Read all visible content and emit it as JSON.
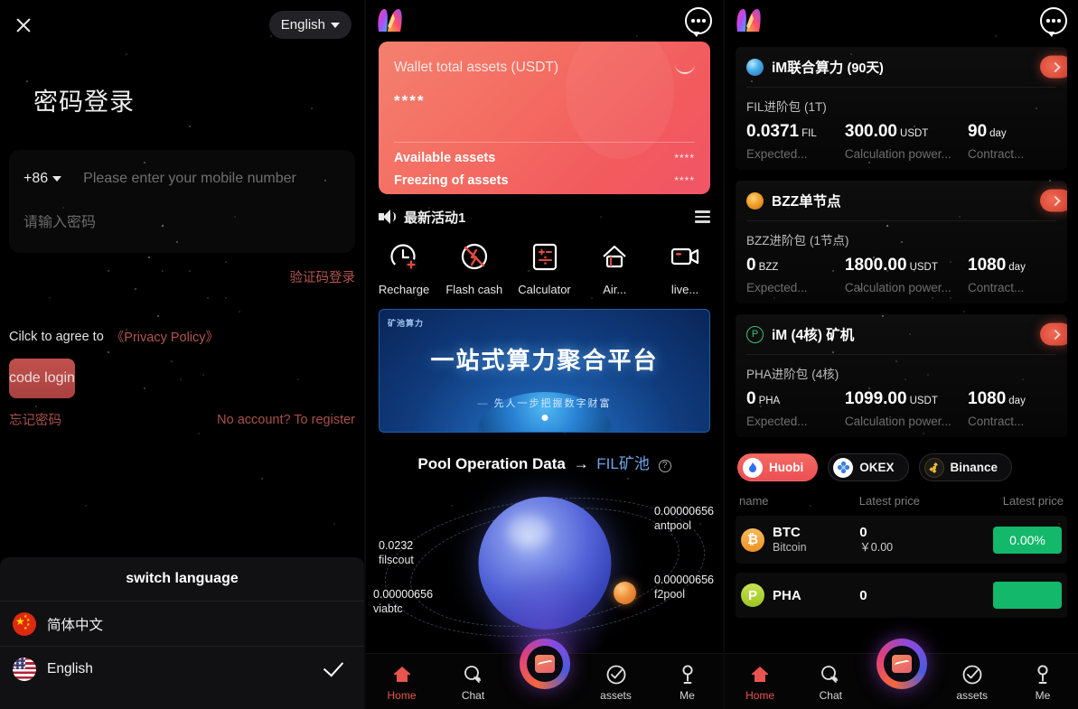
{
  "panel1": {
    "name": "password-login-screen",
    "close_icon": "close-icon",
    "language_selector": {
      "label": "English",
      "caret": "chevron-down-icon"
    },
    "title": "密码登录",
    "country_code": "+86",
    "phone_placeholder": "Please enter your mobile number",
    "phone_value": "",
    "password_placeholder": "请输入密码",
    "password_value": "",
    "sms_login_link": "验证码登录",
    "agree_text": "Cilck to agree to",
    "privacy_link": "《Privacy Policy》",
    "submit_label": "code login",
    "forgot_password": "忘记密码",
    "register_link": "No account? To register",
    "language_sheet": {
      "title": "switch language",
      "items": [
        {
          "label": "简体中文",
          "flag": "flag-china-icon",
          "selected": false
        },
        {
          "label": "English",
          "flag": "flag-usa-icon",
          "selected": true
        }
      ],
      "check_icon": "check-icon"
    }
  },
  "panel2": {
    "name": "wallet-home-screen",
    "logo": "app-logo-icon",
    "more_icon": "more-dots-icon",
    "wallet": {
      "title": "Wallet total assets (USDT)",
      "eye_icon": "eye-off-icon",
      "amount": "****",
      "available_label": "Available assets",
      "available_value": "****",
      "freezing_label": "Freezing of assets",
      "freezing_value": "****"
    },
    "notice": {
      "speaker_icon": "speaker-icon",
      "text": "最新活动1",
      "list_icon": "list-icon"
    },
    "quick_actions": [
      {
        "label": "Recharge",
        "icon": "recharge-icon"
      },
      {
        "label": "Flash cash",
        "icon": "flash-cash-icon"
      },
      {
        "label": "Calculator",
        "icon": "calculator-icon"
      },
      {
        "label": "Air...",
        "icon": "airdrop-icon"
      },
      {
        "label": "live...",
        "icon": "live-video-icon"
      }
    ],
    "banner": {
      "tag": "矿池算力",
      "headline": "一站式算力聚合平台",
      "subline": "先人一步把握数字财富",
      "dot_indicator": "carousel-dot"
    },
    "pool": {
      "heading": "Pool Operation Data",
      "arrow": "→",
      "chip": "FIL矿池",
      "help_icon": "question-icon",
      "labels": [
        {
          "value": "0.00000656",
          "name": "antpool"
        },
        {
          "value": "0.00000656",
          "name": "f2pool"
        },
        {
          "value": "0.0232",
          "name": "filscout"
        },
        {
          "value": "0.00000656",
          "name": "viabtc"
        }
      ]
    },
    "tabs": [
      {
        "label": "Home",
        "icon": "home-icon",
        "active": true
      },
      {
        "label": "Chat",
        "icon": "chat-icon",
        "active": false
      },
      {
        "label": "assets",
        "icon": "assets-icon",
        "active": false
      },
      {
        "label": "Me",
        "icon": "profile-icon",
        "active": false
      }
    ],
    "fab_icon": "market-fab-icon"
  },
  "panel3": {
    "name": "mining-products-screen",
    "logo": "app-logo-icon",
    "more_icon": "more-dots-icon",
    "products": [
      {
        "badge": "fil-badge-icon",
        "title": "iM联合算力",
        "title_suffix": "(90天)",
        "go_icon": "chevron-right-icon",
        "package": "FIL进阶包",
        "package_suffix": "(1T)",
        "col1_value": "0.0371",
        "col1_unit": "FIL",
        "col1_caption": "Expected...",
        "col2_value": "300.00",
        "col2_unit": "USDT",
        "col2_caption": "Calculation power...",
        "col3_value": "90",
        "col3_unit": "day",
        "col3_caption": "Contract..."
      },
      {
        "badge": "bzz-badge-icon",
        "title": "BZZ单节点",
        "title_suffix": "",
        "go_icon": "chevron-right-icon",
        "package": "BZZ进阶包",
        "package_suffix": "(1节点)",
        "col1_value": "0",
        "col1_unit": "BZZ",
        "col1_caption": "Expected...",
        "col2_value": "1800.00",
        "col2_unit": "USDT",
        "col2_caption": "Calculation power...",
        "col3_value": "1080",
        "col3_unit": "day",
        "col3_caption": "Contract..."
      },
      {
        "badge": "pha-badge-icon",
        "title": "iM (4核) 矿机",
        "title_suffix": "",
        "go_icon": "chevron-right-icon",
        "package": "PHA进阶包",
        "package_suffix": "(4核)",
        "col1_value": "0",
        "col1_unit": "PHA",
        "col1_caption": "Expected...",
        "col2_value": "1099.00",
        "col2_unit": "USDT",
        "col2_caption": "Calculation power...",
        "col3_value": "1080",
        "col3_unit": "day",
        "col3_caption": "Contract..."
      }
    ],
    "exchanges": [
      {
        "label": "Huobi",
        "icon": "huobi-icon",
        "active": true
      },
      {
        "label": "OKEX",
        "icon": "okex-icon",
        "active": false
      },
      {
        "label": "Binance",
        "icon": "binance-icon",
        "active": false
      }
    ],
    "table": {
      "headers": [
        "name",
        "Latest price",
        "Latest price"
      ],
      "rows": [
        {
          "symbol": "BTC",
          "name": "Bitcoin",
          "price": "0",
          "price_cny": "￥0.00",
          "change": "0.00%",
          "icon": "bitcoin-icon"
        },
        {
          "symbol": "PHA",
          "name": "",
          "price": "0",
          "price_cny": "",
          "change": "",
          "icon": "pha-coin-icon"
        }
      ],
      "change_color": "#14b86b"
    },
    "tabs": [
      {
        "label": "Home",
        "icon": "home-icon",
        "active": true
      },
      {
        "label": "Chat",
        "icon": "chat-icon",
        "active": false
      },
      {
        "label": "assets",
        "icon": "assets-icon",
        "active": false
      },
      {
        "label": "Me",
        "icon": "profile-icon",
        "active": false
      }
    ],
    "fab_icon": "market-fab-icon"
  },
  "colors": {
    "accent_red": "#e8554f",
    "card_gradient_start": "#f4806f",
    "card_gradient_end": "#f05566",
    "green_badge": "#14b86b",
    "link_red": "#b4544e"
  }
}
